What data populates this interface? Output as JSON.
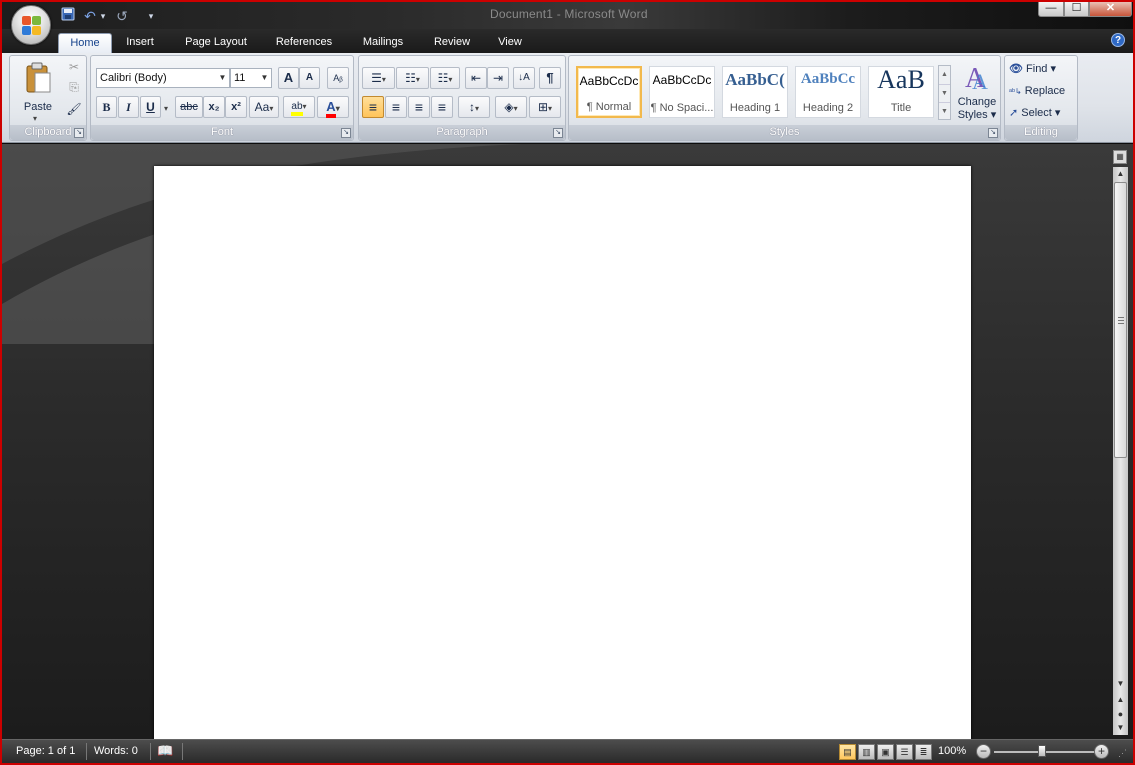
{
  "window": {
    "title": "Document1 - Microsoft Word",
    "min_glyph": "—",
    "max_glyph": "☐",
    "close_glyph": "✕"
  },
  "quick_access": {
    "save_icon": "💾",
    "undo_icon": "↶",
    "undo_dropdown": "▾",
    "redo_icon": "↺",
    "customize": "▾"
  },
  "tabs": [
    {
      "label": "Home",
      "active": true
    },
    {
      "label": "Insert"
    },
    {
      "label": "Page Layout"
    },
    {
      "label": "References"
    },
    {
      "label": "Mailings"
    },
    {
      "label": "Review"
    },
    {
      "label": "View"
    }
  ],
  "help_glyph": "?",
  "clipboard": {
    "label": "Clipboard",
    "paste_label": "Paste",
    "paste_dropdown": "▾",
    "cut_glyph": "✂",
    "copy_glyph": "⎘",
    "format_painter_glyph": "🖌",
    "launcher": "↘"
  },
  "font": {
    "label": "Font",
    "font_name": "Calibri (Body)",
    "font_size": "11",
    "grow_glyph": "A",
    "shrink_glyph": "A",
    "clear_glyph": "Aᵦ",
    "bold": "B",
    "italic": "I",
    "underline": "U",
    "strike": "abc",
    "subscript": "x₂",
    "superscript": "x²",
    "change_case": "Aa",
    "highlight": "ab",
    "font_color": "A",
    "launcher": "↘"
  },
  "paragraph": {
    "label": "Paragraph",
    "bullets": "☰",
    "numbering": "☷",
    "multilevel": "☷",
    "decrease_indent": "⇤",
    "increase_indent": "⇥",
    "sort": "↓A",
    "show_marks": "¶",
    "align_left": "≡",
    "align_center": "≡",
    "align_right": "≡",
    "justify": "≡",
    "line_spacing": "↕",
    "shading": "◈",
    "borders": "⊞",
    "launcher": "↘"
  },
  "styles": {
    "label": "Styles",
    "items": [
      {
        "preview": "AaBbCcDc",
        "name": "¶ Normal",
        "selected": true
      },
      {
        "preview": "AaBbCcDc",
        "name": "¶ No Spaci..."
      },
      {
        "preview": "AaBbC(",
        "name": "Heading 1"
      },
      {
        "preview": "AaBbCc",
        "name": "Heading 2"
      },
      {
        "preview": "AaB",
        "name": "Title"
      }
    ],
    "change_styles_line1": "Change",
    "change_styles_line2": "Styles ▾",
    "launcher": "↘"
  },
  "editing": {
    "label": "Editing",
    "find": "Find ▾",
    "replace": "Replace",
    "select": "Select ▾"
  },
  "status": {
    "page": "Page: 1 of 1",
    "words": "Words: 0",
    "zoom": "100%",
    "zoom_level": 100
  },
  "colors": {
    "accent": "#15428b",
    "selected_style_border": "#f2b94d",
    "highlight_yellow": "#ffff00",
    "font_color_red": "#ff0000",
    "window_frame": "#cc0000"
  }
}
